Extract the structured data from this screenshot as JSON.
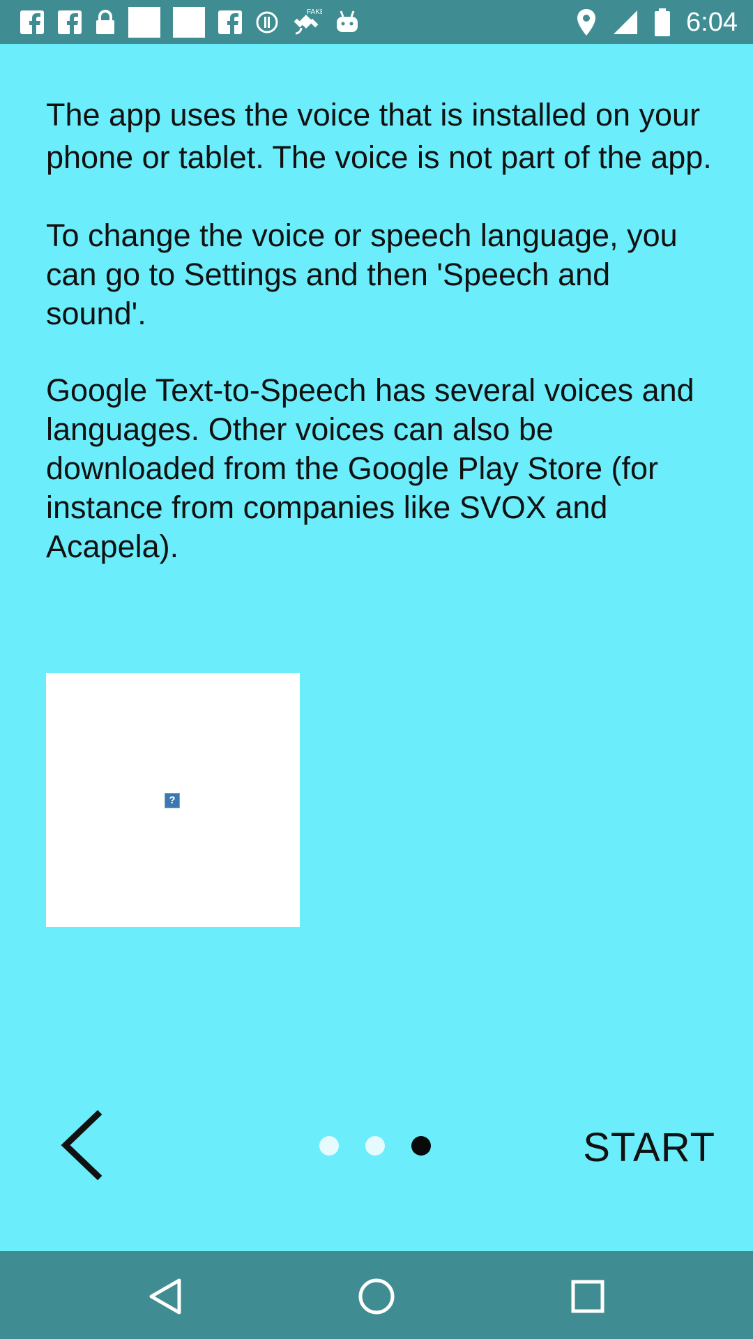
{
  "status_bar": {
    "time": "6:04",
    "left_icons": [
      "facebook-icon",
      "facebook-icon",
      "lock-icon",
      "image-icon",
      "image-icon",
      "facebook-icon",
      "info-icon",
      "fake-gps-icon",
      "android-icon"
    ],
    "right_icons": [
      "location-icon",
      "signal-icon",
      "battery-icon"
    ]
  },
  "content": {
    "paragraph_1": "The app uses the voice that is installed on your phone or tablet. The voice is not part of the app.",
    "paragraph_2": "To change the voice or speech language, you can go to Settings and then 'Speech and sound'.",
    "paragraph_3": "Google Text-to-Speech has several voices and languages. Other voices can also be downloaded from the Google Play Store (for instance from companies like SVOX and Acapela)."
  },
  "image_placeholder": {
    "broken_glyph": "?"
  },
  "footer": {
    "back_icon": "chevron-left-icon",
    "page_count": 3,
    "active_page": 3,
    "start_label": "START"
  },
  "nav_bar": {
    "icons": [
      "nav-back-icon",
      "nav-home-icon",
      "nav-recents-icon"
    ]
  },
  "colors": {
    "background": "#6bedfb",
    "bars": "#3f8d93",
    "text": "#111111"
  }
}
